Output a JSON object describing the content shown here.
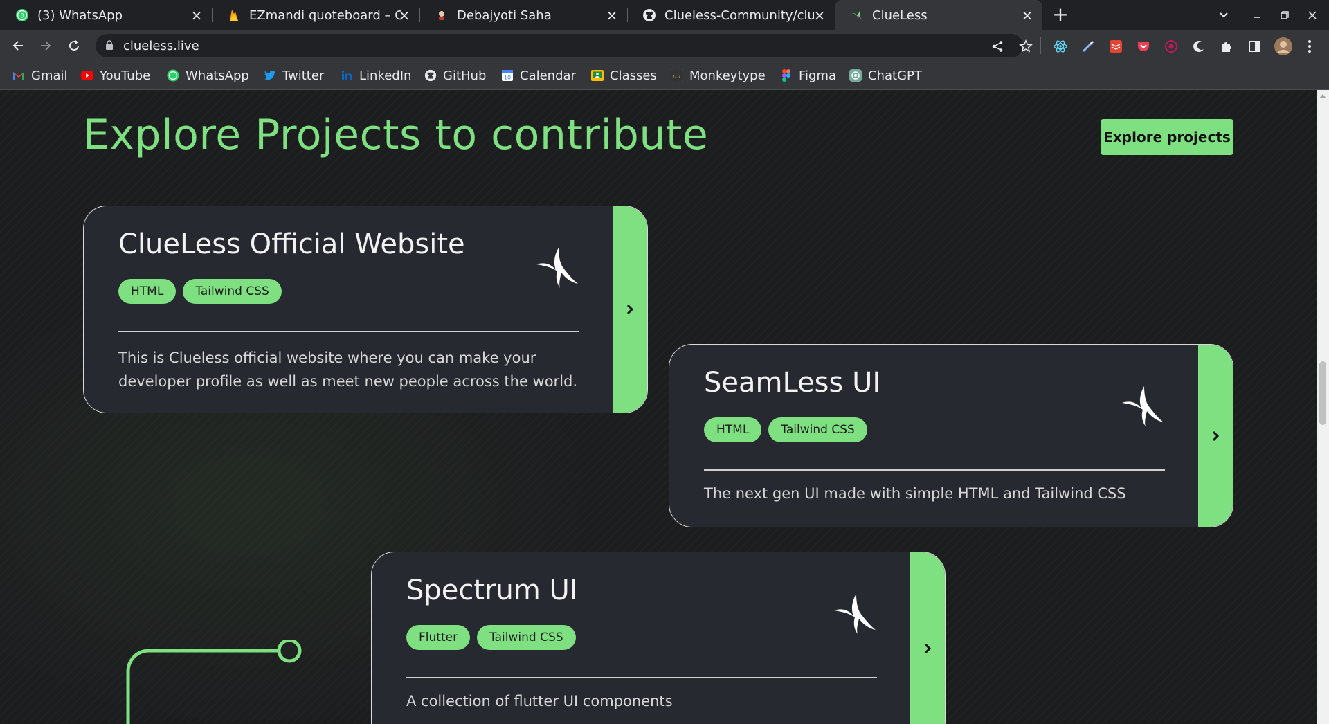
{
  "browser": {
    "tabs": [
      {
        "title": "(3) WhatsApp",
        "icon": "whatsapp-icon"
      },
      {
        "title": "EZmandi quoteboard – Clo",
        "icon": "firebase-icon"
      },
      {
        "title": "Debajyoti Saha",
        "icon": "portfolio-icon"
      },
      {
        "title": "Clueless-Community/clue",
        "icon": "github-icon"
      },
      {
        "title": "ClueLess",
        "icon": "clueless-icon",
        "active": true
      }
    ],
    "url": "clueless.live",
    "bookmarks": [
      "Gmail",
      "YouTube",
      "WhatsApp",
      "Twitter",
      "LinkedIn",
      "GitHub",
      "Calendar",
      "Classes",
      "Monkeytype",
      "Figma",
      "ChatGPT"
    ],
    "whatsapp_badge": "3",
    "calendar_day": "10",
    "monkeytype_glyph": "mt"
  },
  "page": {
    "heading": "Explore Projects to contribute",
    "explore_button": "Explore projects",
    "projects": [
      {
        "title": "ClueLess Official Website",
        "tags": [
          "HTML",
          "Tailwind CSS"
        ],
        "description": "This is Clueless official website where you can make your developer profile as well as meet new people across the world."
      },
      {
        "title": "SeamLess UI",
        "tags": [
          "HTML",
          "Tailwind CSS"
        ],
        "description": "The next gen UI made with simple HTML and Tailwind CSS"
      },
      {
        "title": "Spectrum UI",
        "tags": [
          "Flutter",
          "Tailwind CSS"
        ],
        "description": "A collection of flutter UI components"
      }
    ]
  },
  "colors": {
    "accent": "#7ee081",
    "card_bg": "#262a30",
    "page_bg": "#1c1d1f",
    "chrome_dark": "#202124",
    "chrome_light": "#35363a"
  }
}
